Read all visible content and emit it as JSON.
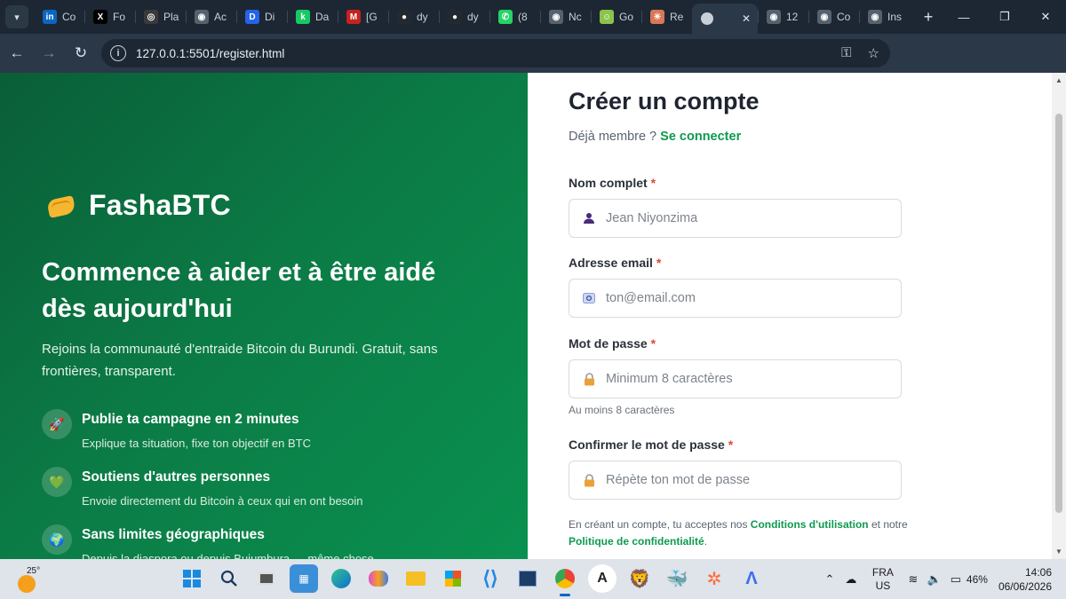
{
  "browser": {
    "tabs": [
      {
        "label": "Co",
        "icon": "linkedin-icon",
        "color": "#0a66c2",
        "glyph": "in"
      },
      {
        "label": "Fo",
        "icon": "x-icon",
        "color": "#000000",
        "glyph": "X"
      },
      {
        "label": "Pla",
        "icon": "openai-icon",
        "color": "#3a3a3a",
        "glyph": "◎"
      },
      {
        "label": "Ac",
        "icon": "globe-icon",
        "color": "#55616d",
        "glyph": "◉"
      },
      {
        "label": "Di",
        "icon": "dify-icon",
        "color": "#2563eb",
        "glyph": "D"
      },
      {
        "label": "Da",
        "icon": "dashboard-icon",
        "color": "#17c964",
        "glyph": "k"
      },
      {
        "label": "[G",
        "icon": "gmail-icon",
        "color": "#c5221f",
        "glyph": "M"
      },
      {
        "label": "dy",
        "icon": "github-icon",
        "color": "#24292f",
        "glyph": "●"
      },
      {
        "label": "dy",
        "icon": "github-icon",
        "color": "#24292f",
        "glyph": "●"
      },
      {
        "label": "(8",
        "icon": "whatsapp-icon",
        "color": "#25d366",
        "glyph": "✆"
      },
      {
        "label": "Nc",
        "icon": "globe-icon",
        "color": "#55616d",
        "glyph": "◉"
      },
      {
        "label": "Go",
        "icon": "smile-icon",
        "color": "#8bc34a",
        "glyph": "☺"
      },
      {
        "label": "Re",
        "icon": "claude-icon",
        "color": "#d97757",
        "glyph": "✳"
      }
    ],
    "active_tab": {
      "icon": "globe-icon",
      "close": "✕"
    },
    "tabs_after": [
      {
        "label": "12",
        "icon": "globe-icon",
        "color": "#55616d",
        "glyph": "◉"
      },
      {
        "label": "Co",
        "icon": "globe-icon",
        "color": "#55616d",
        "glyph": "◉"
      },
      {
        "label": "Ins",
        "icon": "globe-icon",
        "color": "#55616d",
        "glyph": "◉"
      }
    ],
    "new_tab": "+",
    "url": "127.0.0.1:5501/register.html"
  },
  "hero": {
    "brand": "FashaBTC",
    "headline": "Commence à aider et à être aidé dès aujourd'hui",
    "lead": "Rejoins la communauté d'entraide Bitcoin du Burundi. Gratuit, sans frontières, transparent.",
    "features": [
      {
        "icon": "rocket-icon",
        "glyph": "🚀",
        "title": "Publie ta campagne en 2 minutes",
        "desc": "Explique ta situation, fixe ton objectif en BTC"
      },
      {
        "icon": "heart-icon",
        "glyph": "💚",
        "title": "Soutiens d'autres personnes",
        "desc": "Envoie directement du Bitcoin à ceux qui en ont besoin"
      },
      {
        "icon": "globe-icon",
        "glyph": "🌍",
        "title": "Sans limites géographiques",
        "desc": "Depuis la diaspora ou depuis Bujumbura — même chose."
      }
    ]
  },
  "form": {
    "title": "Créer un compte",
    "already_member": "Déjà membre ?",
    "login_link": "Se connecter",
    "required_mark": "*",
    "fields": {
      "name": {
        "label": "Nom complet",
        "placeholder": "Jean Niyonzima"
      },
      "email": {
        "label": "Adresse email",
        "placeholder": "ton@email.com"
      },
      "password": {
        "label": "Mot de passe",
        "placeholder": "Minimum 8 caractères",
        "hint": "Au moins 8 caractères"
      },
      "confirm": {
        "label": "Confirmer le mot de passe",
        "placeholder": "Répète ton mot de passe"
      }
    },
    "terms_prefix": "En créant un compte, tu acceptes nos",
    "terms_link": "Conditions d'utilisation",
    "terms_mid": "et notre",
    "privacy_link": "Politique de confidentialité",
    "terms_end": "."
  },
  "taskbar": {
    "temperature": "25°",
    "language": "FRA",
    "region": "US",
    "battery": "46%",
    "time": "14:06",
    "date": "06/06/2026"
  },
  "colors": {
    "accent": "#0e9a4f",
    "hero_start": "#0a5e38",
    "hero_end": "#0a9150",
    "required": "#e0463a"
  }
}
